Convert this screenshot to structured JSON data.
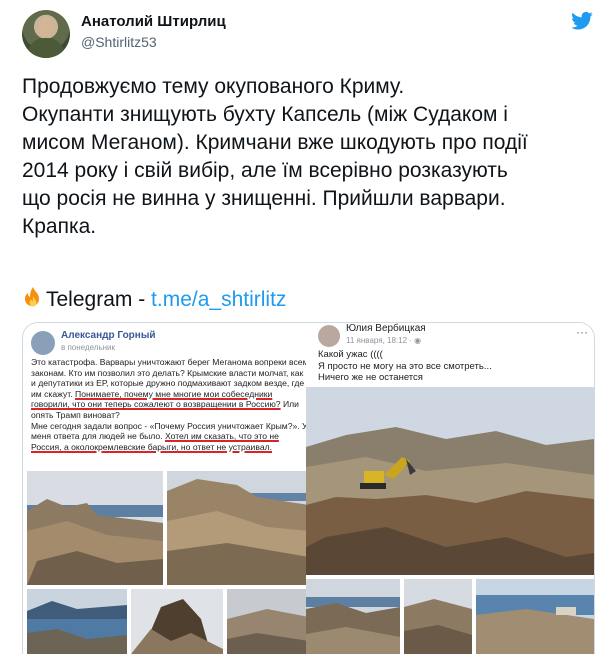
{
  "author": {
    "name": "Анатолий Штирлиц",
    "handle": "@Shtirlitz53"
  },
  "tweet": {
    "lines": [
      "Продовжуємо тему окупованого Криму.",
      "Окупанти знищують бухту Капсель (між Судаком і",
      "мисом Меганом). Кримчани вже шкодують про події",
      "2014 року і свій вибір, але їм всерівно розказують",
      "що росія не винна у знищенні. Прийшли варвари.",
      "Крапка."
    ],
    "telegram_label": "Telegram - ",
    "telegram_link": "t.me/a_shtirlitz"
  },
  "media": {
    "left_post": {
      "name": "Александр Горный",
      "time": "в понедельник",
      "text_before_1": "Это катастрофа. Варвары уничтожают берег Меганома вопреки всем законам. Кто им позволил это делать? Крымские власти молчат, как и депутатики из ЕР, которые дружно подмахивают задком везде, где им скажут. ",
      "highlight_1": "Понимаете, почему мне многие мои собеседники говорили, что они теперь сожалеют о возвращении в Россию?",
      "text_after_1": " Или опять Трамп виноват?",
      "text_before_2": "Мне сегодня задали вопрос - «Почему Россия уничтожает Крым?». У меня ответа для людей не было. ",
      "highlight_2": "Хотел им сказать, что это не Россия, а околокремлевские барыги, но ответ не устраивал."
    },
    "right_post": {
      "name": "Юлия Вербицкая",
      "date": "11 января, 18:12 · ",
      "more": "···",
      "line1": "Какой ужас ((((",
      "line2": "Я просто не могу на это все смотреть...",
      "line3": "Ничего же не останется"
    }
  },
  "colors": {
    "link": "#1d9bf0",
    "text": "#0f1419",
    "secondary": "#536471",
    "underline_red": "#d6262b"
  }
}
